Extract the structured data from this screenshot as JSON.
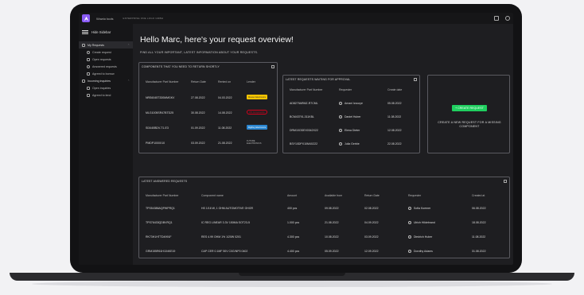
{
  "topbar": {
    "app_name": "Wowio tools",
    "company": "ENTERPRISE ONE LOGO GMBH"
  },
  "sidebar": {
    "hide_label": "Hide Sidebar",
    "groups": [
      {
        "label": "My Requests",
        "active": true,
        "items": [
          "Create request",
          "Open requests",
          "Answered requests",
          "Agreed to borrow"
        ]
      },
      {
        "label": "Incoming inquiries",
        "active": false,
        "items": [
          "Open inquiries",
          "Agreed to lend"
        ]
      }
    ]
  },
  "header": {
    "greeting": "Hello Marc, here's your request overview!",
    "subtitle": "FIND ALL YOUR IMPORTANT, LATEST INFORMATION ABOUT YOUR REQUESTS."
  },
  "components": {
    "title": "COMPONENTS THAT YOU NEED TO RETURN SHORTLY",
    "columns": [
      "Manufacturer Part Number",
      "Return Date",
      "Rented on",
      "Lender"
    ],
    "rows": [
      {
        "part": "NRS6045T330MMGKV",
        "return": "27.08.2022",
        "rented": "04.03.2022",
        "lender": "Mouser Electronics",
        "vendor": "mouser"
      },
      {
        "part": "MLG1005SR47BTD25",
        "return": "30.08.2022",
        "rented": "14.08.2022",
        "lender": "RS Components",
        "vendor": "rs"
      },
      {
        "part": "SI3440BDV-T1-E3",
        "return": "01.09.2022",
        "rented": "11.08.2022",
        "lender": "DigiKey Electronics",
        "vendor": "digikey"
      },
      {
        "part": "PMDP1000X10",
        "return": "03.09.2022",
        "rented": "21.08.2022",
        "lender": "FUTURE ELECTRONICS",
        "vendor": "future"
      }
    ]
  },
  "approvals": {
    "title": "LATEST REQUESTS WAITING FOR APPROVAL",
    "columns": [
      "Manufacturer Part Number",
      "Requester",
      "Create date"
    ],
    "rows": [
      {
        "part": "AD8279ARMZ-R7CML",
        "requester": "Amani Izvuoye",
        "date": "05.08.2022"
      },
      {
        "part": "BCM43791-311KBL",
        "requester": "Daniel Huber",
        "date": "11.08.2022"
      },
      {
        "part": "DRM10ODEX0342X22",
        "requester": "Elena Dieter",
        "date": "12.08.2022"
      },
      {
        "part": "BSY10DPX10M4X222",
        "requester": "Julia Gerbie",
        "date": "22.08.2022"
      }
    ]
  },
  "create": {
    "button_label": "+ CREATE REQUEST",
    "text": "CREATE A NEW REQUEST FOR A MISSING COMPONENT"
  },
  "answered": {
    "title": "LATEST ANSWERED REQUESTS",
    "columns": [
      "Manufacturer Part Number",
      "Component name",
      "Amount",
      "Available from",
      "Return Date",
      "Requester",
      "Created at"
    ],
    "rows": [
      {
        "part": "TPS54386AQPWPRQ1",
        "name": "HS 1/16 W, 1 OHM AUTOMOTIVE OHGR",
        "amount": "400 pcs",
        "available": "09.08.2022",
        "return": "02.08.2022",
        "requester": "Sofia Koemer",
        "created": "06.08.2022"
      },
      {
        "part": "TPS76433QDBVRQ1",
        "name": "IC REG LINEAR 3.3V 150MA SOT23-5",
        "amount": "1.000 pcs",
        "available": "21.08.2022",
        "return": "04.09.2022",
        "requester": "Ulrich Hildebrand",
        "created": "18.08.2022"
      },
      {
        "part": "RK73H1HTTD4991F",
        "name": "RES 4.99 OHM 1% 1/20W 0201",
        "amount": "4.300 pcs",
        "available": "10.08.2022",
        "return": "03.09.2022",
        "requester": "Diedrich Huber",
        "created": "11.08.2022"
      },
      {
        "part": "GRM155R61H104KE19",
        "name": "CAP CER 0.1MF 50V C0G/NP0 0402",
        "amount": "4.400 pcs",
        "available": "05.09.2022",
        "return": "12.09.2022",
        "requester": "Dorothy Adams",
        "created": "31.08.2022"
      }
    ]
  },
  "colors": {
    "accent": "#8b5cf6",
    "create_button": "#1fcf5f",
    "background": "#1e1e21",
    "sidebar": "#161618"
  }
}
